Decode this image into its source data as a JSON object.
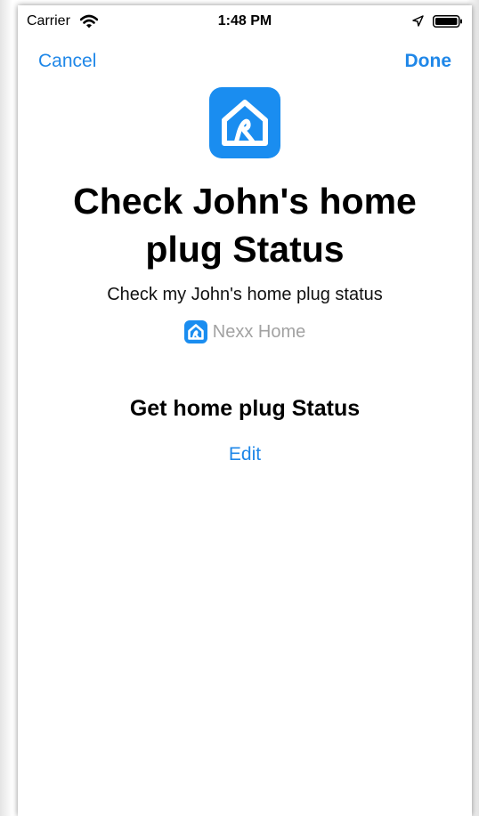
{
  "status_bar": {
    "carrier": "Carrier",
    "time": "1:48 PM"
  },
  "nav": {
    "cancel_label": "Cancel",
    "done_label": "Done"
  },
  "shortcut": {
    "title": "Check John's home plug Status",
    "subtitle": "Check my John's home plug status",
    "app_name": "Nexx Home",
    "app_icon": "house-with-loop-icon"
  },
  "action": {
    "heading": "Get home plug Status",
    "edit_label": "Edit"
  },
  "colors": {
    "accent": "#1f87e8",
    "app_icon_bg": "#1a8df0",
    "secondary_text": "#a2a2a2"
  }
}
